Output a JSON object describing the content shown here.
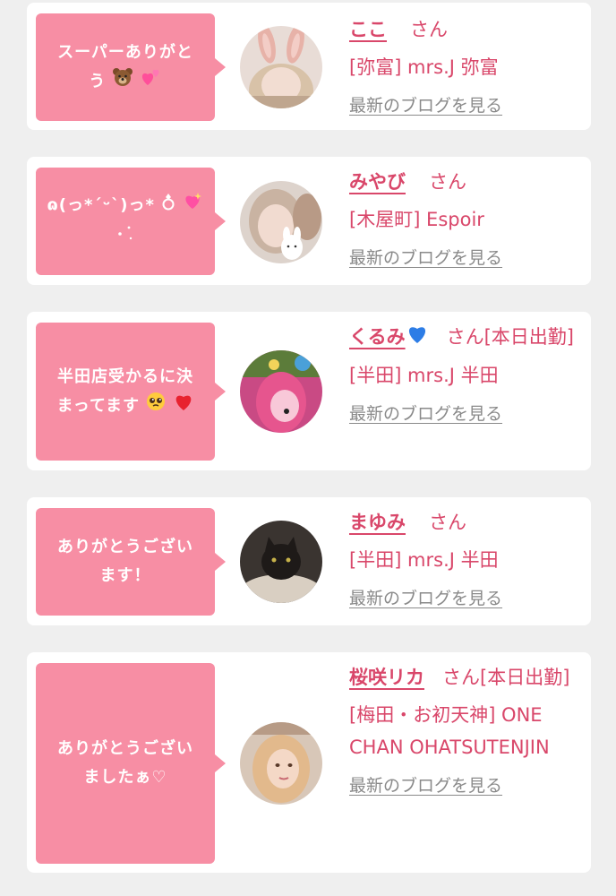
{
  "blog_link_label": "最新のブログを見る",
  "cards": [
    {
      "message_text": "スーパーありがと",
      "message_text_2": "う",
      "message_emojis": [
        "bear-emoji",
        "two-hearts-emoji"
      ],
      "girl_name": "ここ",
      "suffix": "さん",
      "shop": "[弥富] mrs.J 弥富"
    },
    {
      "message_text": "ɷ(っ*ˊᵕˋ)っ*",
      "message_emojis": [
        "ring-emoji",
        "sparkling-heart-emoji",
        "sparkles-emoji"
      ],
      "girl_name": "みやび",
      "suffix": "さん",
      "shop": "[木屋町] Espoir"
    },
    {
      "message_text": "半田店受かるに決",
      "message_text_2": "まってます",
      "message_emojis": [
        "pleading-face-emoji",
        "red-heart-emoji"
      ],
      "girl_name": "くるみ",
      "name_emoji": "blue-heart-emoji",
      "suffix": "さん[本日出勤]",
      "shop": "[半田] mrs.J 半田"
    },
    {
      "message_text": "ありがとうござい",
      "message_text_2": "ます！",
      "girl_name": "まゆみ",
      "suffix": "さん",
      "shop": "[半田] mrs.J 半田"
    },
    {
      "message_text": "ありがとうござい",
      "message_text_2": "ましたぁ♡",
      "girl_name": "桜咲リカ",
      "suffix": "さん[本日出勤]",
      "shop": "[梅田・お初天神] ONE CHAN OHATSUTENJIN"
    }
  ],
  "colors": {
    "accent_pink": "#f78ea4",
    "name_pink": "#d9476a",
    "link_gray": "#8a8a8a",
    "background": "#efefef"
  }
}
